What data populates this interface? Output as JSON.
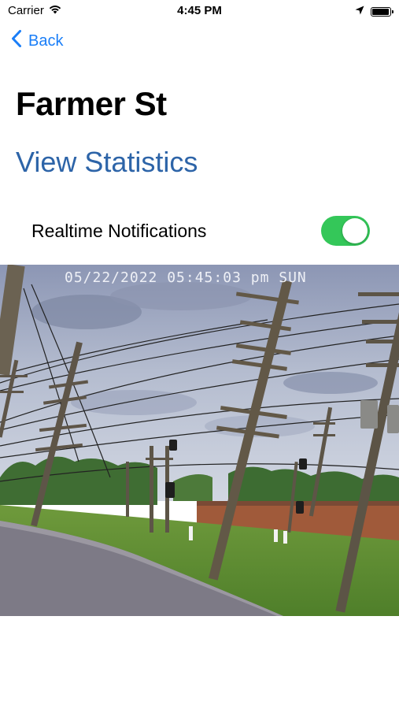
{
  "status_bar": {
    "carrier": "Carrier",
    "time": "4:45 PM",
    "battery_level": 0.95,
    "icons": [
      "wifi-icon",
      "location-arrow-icon",
      "battery-icon"
    ]
  },
  "nav": {
    "back_label": "Back",
    "icon": "chevron-left-icon"
  },
  "page": {
    "title": "Farmer St",
    "view_statistics": "View Statistics"
  },
  "notifications": {
    "label": "Realtime Notifications",
    "enabled": true
  },
  "camera": {
    "timestamp": "05/22/2022 05:45:03 pm SUN"
  },
  "colors": {
    "link_blue": "#1a7ef7",
    "stats_blue": "#2d64a8",
    "toggle_on": "#34c759"
  }
}
